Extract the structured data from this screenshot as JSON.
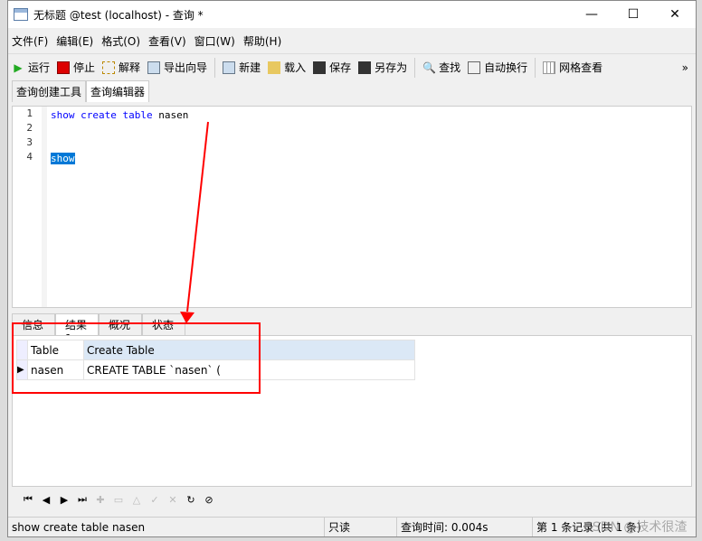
{
  "window": {
    "title": "无标题 @test (localhost) - 查询 *",
    "minimize": "—",
    "maximize": "☐",
    "close": "✕"
  },
  "menu": [
    "文件(F)",
    "编辑(E)",
    "格式(O)",
    "查看(V)",
    "窗口(W)",
    "帮助(H)"
  ],
  "toolbar": {
    "run": "运行",
    "stop": "停止",
    "explain": "解释",
    "export": "导出向导",
    "new": "新建",
    "load": "载入",
    "save": "保存",
    "save_as": "另存为",
    "find": "查找",
    "wrap": "自动换行",
    "grid_view": "网格查看",
    "more": "»"
  },
  "tabs": [
    "查询创建工具",
    "查询编辑器"
  ],
  "editor": {
    "line_numbers": [
      "1",
      "2",
      "3",
      "4"
    ],
    "lines": [
      [
        "show",
        "create",
        "table",
        "nasen"
      ],
      [],
      [],
      [
        "show"
      ]
    ]
  },
  "result_tabs": [
    "信息",
    "结果1",
    "概况",
    "状态"
  ],
  "grid": {
    "columns": [
      "Table",
      "Create Table"
    ],
    "rows": [
      [
        "nasen",
        "CREATE TABLE `nasen` ("
      ]
    ]
  },
  "nav": [
    "⏮",
    "◀",
    "▶",
    "⏭",
    "✚",
    "▭",
    "△",
    "✓",
    "✕",
    "↻",
    "⊘"
  ],
  "status": {
    "sql": "show create table nasen",
    "mode": "只读",
    "time": "查询时间: 0.004s",
    "record": "第 1 条记录 (共 1 条)"
  },
  "watermark": "CSDN @技术很渣",
  "colors": {
    "keyword": "#0000ff",
    "selection": "#0078d7",
    "annotation": "#ff0000",
    "header_highlight": "#dbe8f6"
  }
}
